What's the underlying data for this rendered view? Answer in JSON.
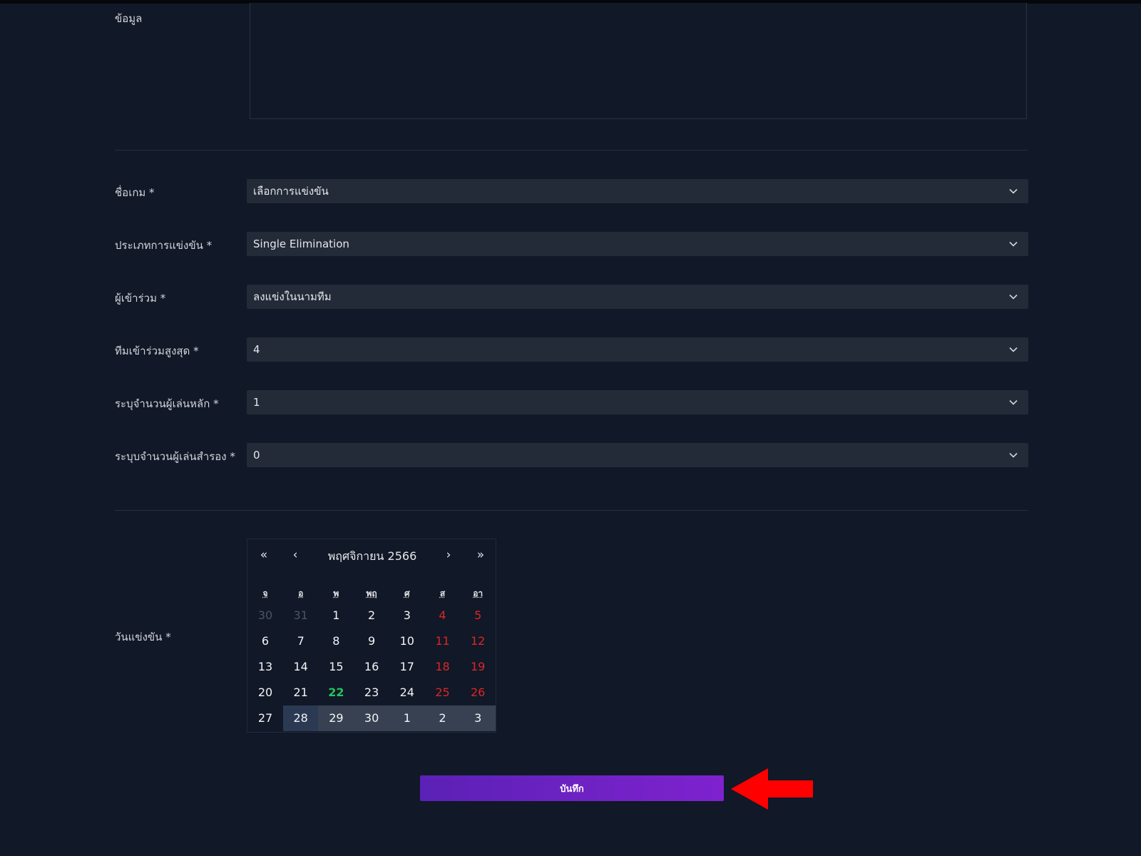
{
  "form": {
    "info_label": "ข้อมูล",
    "fields": [
      {
        "label": "ชื่อเกม *",
        "value": "เลือกการแข่งขัน"
      },
      {
        "label": "ประเภทการแข่งขัน *",
        "value": "Single Elimination"
      },
      {
        "label": "ผู้เข้าร่วม *",
        "value": "ลงแข่งในนามทีม"
      },
      {
        "label": "ทีมเข้าร่วมสูงสุด *",
        "value": "4"
      },
      {
        "label": "ระบุจำนวนผู้เล่นหลัก *",
        "value": "1"
      },
      {
        "label": "ระบุบจำนวนผู้เล่นสำรอง *",
        "value": "0"
      }
    ],
    "date_label": "วันแข่งขัน *",
    "save_label": "บันทึก"
  },
  "calendar": {
    "title": "พฤศจิกายน 2566",
    "nav": {
      "prev_year": "«",
      "prev_month": "‹",
      "next_month": "›",
      "next_year": "»"
    },
    "weekdays": [
      "จ",
      "อ",
      "พ",
      "พฤ",
      "ศ",
      "ส",
      "อา"
    ],
    "weeks": [
      [
        "30",
        "31",
        "1",
        "2",
        "3",
        "4",
        "5"
      ],
      [
        "6",
        "7",
        "8",
        "9",
        "10",
        "11",
        "12"
      ],
      [
        "13",
        "14",
        "15",
        "16",
        "17",
        "18",
        "19"
      ],
      [
        "20",
        "21",
        "22",
        "23",
        "24",
        "25",
        "26"
      ],
      [
        "27",
        "28",
        "29",
        "30",
        "1",
        "2",
        "3"
      ]
    ],
    "today": "22",
    "selected_range": [
      "28",
      "3"
    ]
  },
  "colors": {
    "background": "#111827",
    "input": "#232b38",
    "accent": "#7e22ce",
    "weekend": "#dc2626",
    "today": "#22c55e",
    "annotation_arrow": "#ff0000"
  },
  "icons": {
    "select_chevron": "chevron-down-icon",
    "annotation": "arrow-left-icon"
  }
}
